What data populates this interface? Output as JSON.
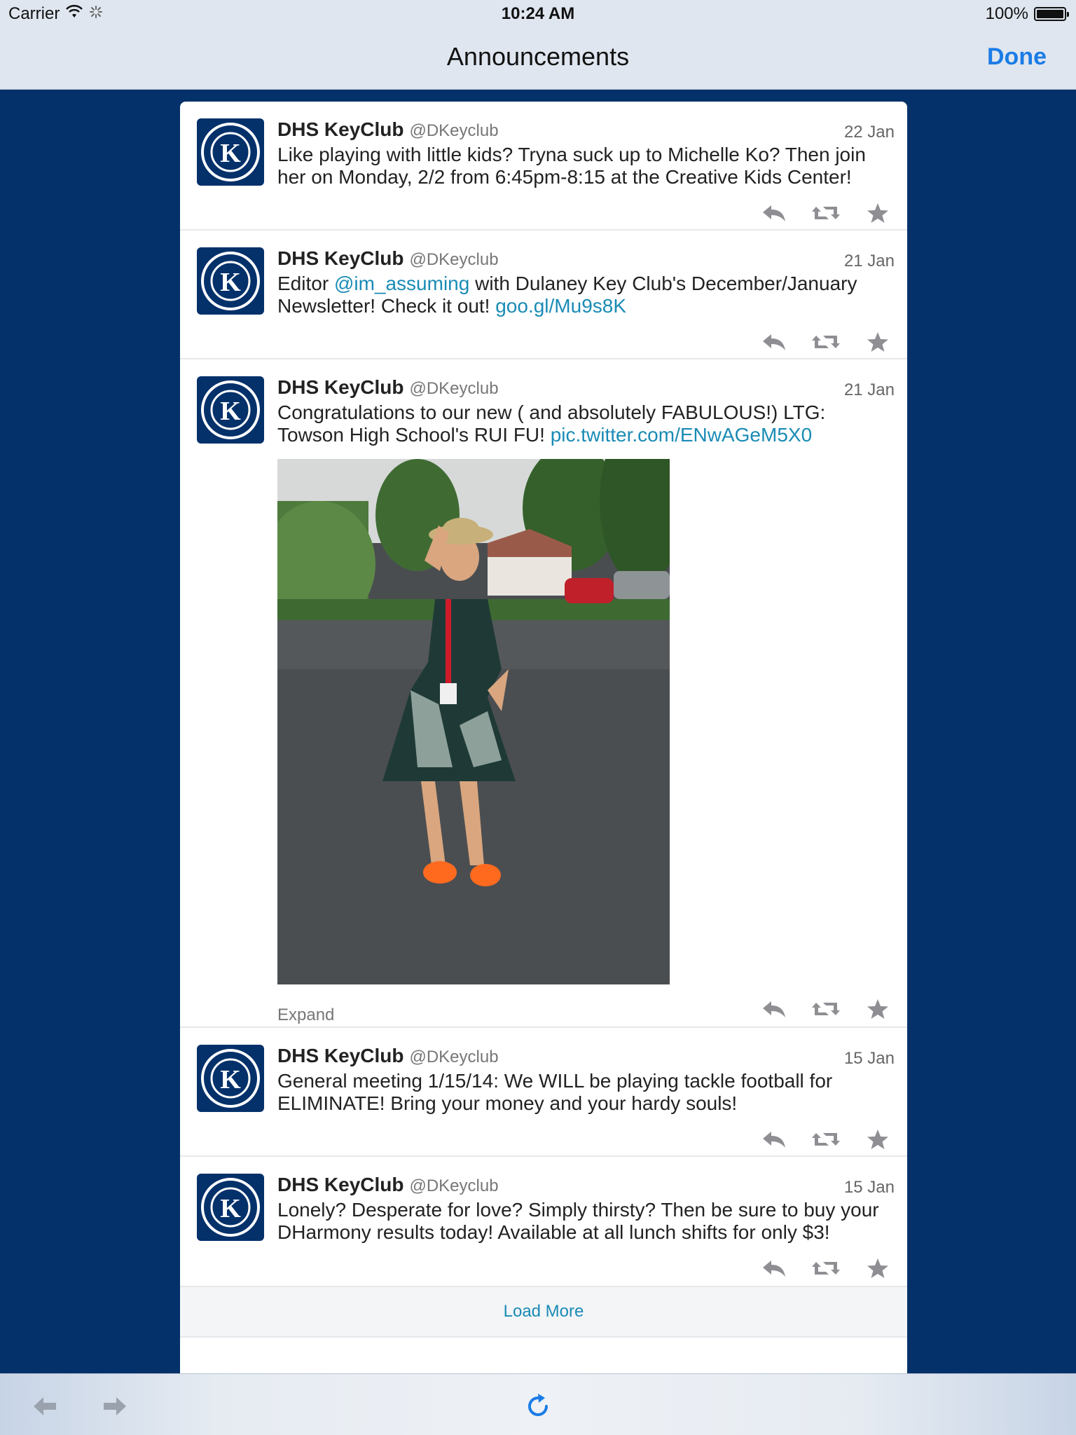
{
  "status_bar": {
    "carrier": "Carrier",
    "time": "10:24 AM",
    "battery": "100%"
  },
  "nav": {
    "title": "Announcements",
    "done_label": "Done"
  },
  "tweets": [
    {
      "name": "DHS KeyClub",
      "handle": "@DKeyclub",
      "date": "22 Jan",
      "text": "Like playing with little kids? Tryna suck up to Michelle Ko? Then join her on Monday, 2/2 from 6:45pm-8:15 at the Creative Kids Center!"
    },
    {
      "name": "DHS KeyClub",
      "handle": "@DKeyclub",
      "date": "21 Jan",
      "text_1": "Editor ",
      "mention": "@im_assuming",
      "text_2": " with Dulaney Key Club's December/January Newsletter! Check it out! ",
      "link": "goo.gl/Mu9s8K"
    },
    {
      "name": "DHS KeyClub",
      "handle": "@DKeyclub",
      "date": "21 Jan",
      "text_1": "Congratulations to our new ( and absolutely FABULOUS!) LTG: Towson High School's RUI FU! ",
      "link": "pic.twitter.com/ENwAGeM5X0",
      "expand_label": "Expand"
    },
    {
      "name": "DHS KeyClub",
      "handle": "@DKeyclub",
      "date": "15 Jan",
      "text": "General meeting 1/15/14: We WILL be playing tackle football for ELIMINATE! Bring your money and your hardy souls!"
    },
    {
      "name": "DHS KeyClub",
      "handle": "@DKeyclub",
      "date": "15 Jan",
      "text": "Lonely? Desperate for love? Simply thirsty? Then be sure to buy your DHarmony results today! Available at all lunch shifts for only $3!"
    }
  ],
  "load_more_label": "Load More",
  "colors": {
    "background": "#04316a",
    "link": "#1a8bb5",
    "accent": "#1b7ce6",
    "action_icon": "#8e8e93"
  },
  "icons": [
    "wifi-icon",
    "activity-spinner-icon",
    "battery-icon",
    "avatar-logo",
    "reply-icon",
    "retweet-icon",
    "favorite-icon",
    "back-arrow-icon",
    "forward-arrow-icon",
    "refresh-icon"
  ]
}
